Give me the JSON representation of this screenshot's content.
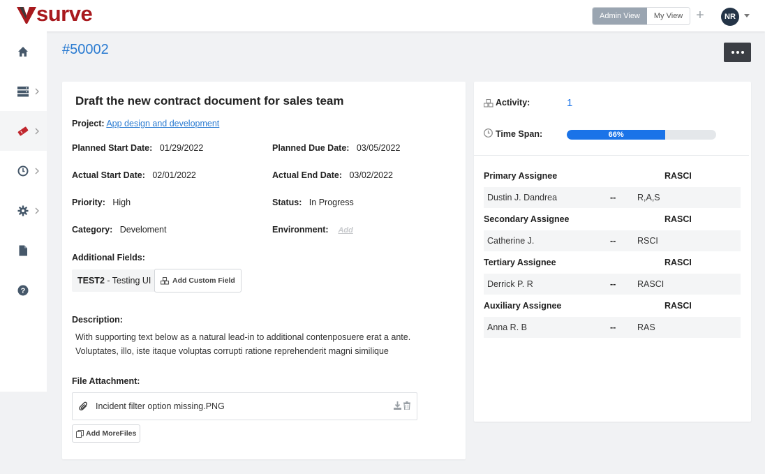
{
  "app": {
    "logo": "surve",
    "brand_color": "#a8191d",
    "accent_color": "#2a7bd1"
  },
  "header": {
    "view_toggle": [
      {
        "label": "Admin View",
        "active": true
      },
      {
        "label": "My View",
        "active": false
      }
    ],
    "add_icon": "plus-icon",
    "avatar_initials": "NR"
  },
  "sidebar": {
    "items": [
      {
        "icon": "home-icon",
        "has_children": false
      },
      {
        "icon": "server-icon",
        "has_children": true
      },
      {
        "icon": "ticket-icon",
        "has_children": true,
        "active": true
      },
      {
        "icon": "clock-icon",
        "has_children": true
      },
      {
        "icon": "gear-icon",
        "has_children": true
      },
      {
        "icon": "document-icon",
        "has_children": false
      },
      {
        "icon": "help-icon",
        "has_children": false
      }
    ]
  },
  "ticket": {
    "id": "#50002",
    "title": "Draft the new contract document for sales team",
    "project_label": "Project:",
    "project_value": "App design and development",
    "planned_start_label": "Planned Start Date:",
    "planned_start_value": "01/29/2022",
    "planned_due_label": "Planned Due Date:",
    "planned_due_value": "03/05/2022",
    "actual_start_label": "Actual Start Date:",
    "actual_start_value": "02/01/2022",
    "actual_end_label": "Actual End Date:",
    "actual_end_value": "03/02/2022",
    "priority_label": "Priority:",
    "priority_value": "High",
    "status_label": "Status:",
    "status_value": "In Progress",
    "category_label": "Category:",
    "category_value": "Develoment",
    "environment_label": "Environment:",
    "environment_value": "Add",
    "additional_fields_label": "Additional Fields:",
    "custom_field_name": "TEST2",
    "custom_field_value": "- Testing UI",
    "add_custom_field_label": "Add Custom Field",
    "description_label": "Description:",
    "description_text": "With supporting text below as a natural lead-in to additional contenposuere erat a ante. Voluptates, illo, iste itaque voluptas corrupti ratione reprehenderit magni similique",
    "file_attachment_label": "File Attachment:",
    "file_name": "Incident filter option missing.PNG",
    "add_more_files_label": "Add MoreFiles"
  },
  "summary": {
    "activity_label": "Activity:",
    "activity_value": "1",
    "timespan_label": "Time Span:",
    "timespan_percent": 66,
    "timespan_text": "66%",
    "rasci_label": "RASCI",
    "dash": "--",
    "assignees": [
      {
        "heading": "Primary Assignee",
        "name": "Dustin J. Dandrea",
        "role": "R,A,S"
      },
      {
        "heading": "Secondary Assignee",
        "name": "Catherine J.",
        "role": "RSCI"
      },
      {
        "heading": "Tertiary Assignee",
        "name": "Derrick P. R",
        "role": "RASCI"
      },
      {
        "heading": "Auxiliary Assignee",
        "name": "Anna R. B",
        "role": "RAS"
      }
    ]
  }
}
